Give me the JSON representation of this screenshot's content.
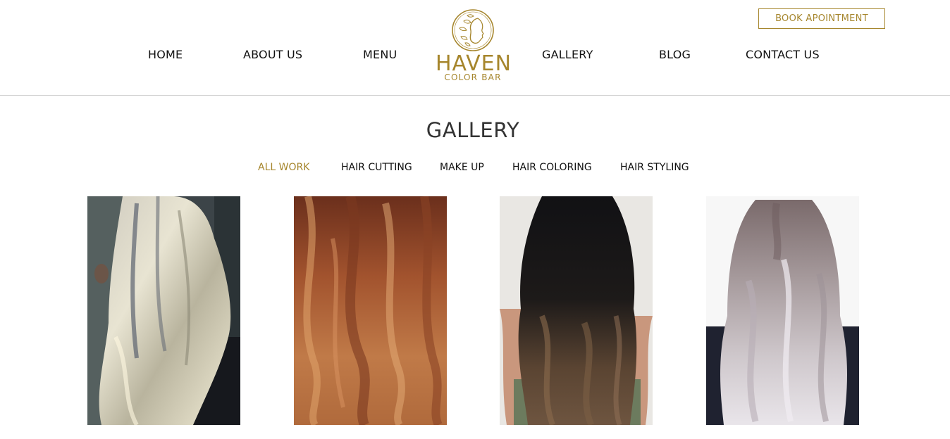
{
  "header": {
    "book_button": "BOOK APOINTMENT",
    "nav_left": [
      "HOME",
      "ABOUT US",
      "MENU"
    ],
    "nav_right": [
      "GALLERY",
      "BLOG",
      "CONTACT US"
    ],
    "logo": {
      "name": "HAVEN",
      "sub": "COLOR BAR",
      "color": "#a6862d"
    }
  },
  "main": {
    "title": "GALLERY",
    "filters": [
      "ALL WORK",
      "HAIR CUTTING",
      "MAKE UP",
      "HAIR COLORING",
      "HAIR STYLING"
    ],
    "active_filter": "ALL WORK",
    "accent_color": "#a6862d",
    "gallery": [
      {
        "name": "blonde-highlights-photo"
      },
      {
        "name": "copper-waves-photo"
      },
      {
        "name": "dark-balayage-photo"
      },
      {
        "name": "ash-silver-waves-photo"
      }
    ]
  }
}
